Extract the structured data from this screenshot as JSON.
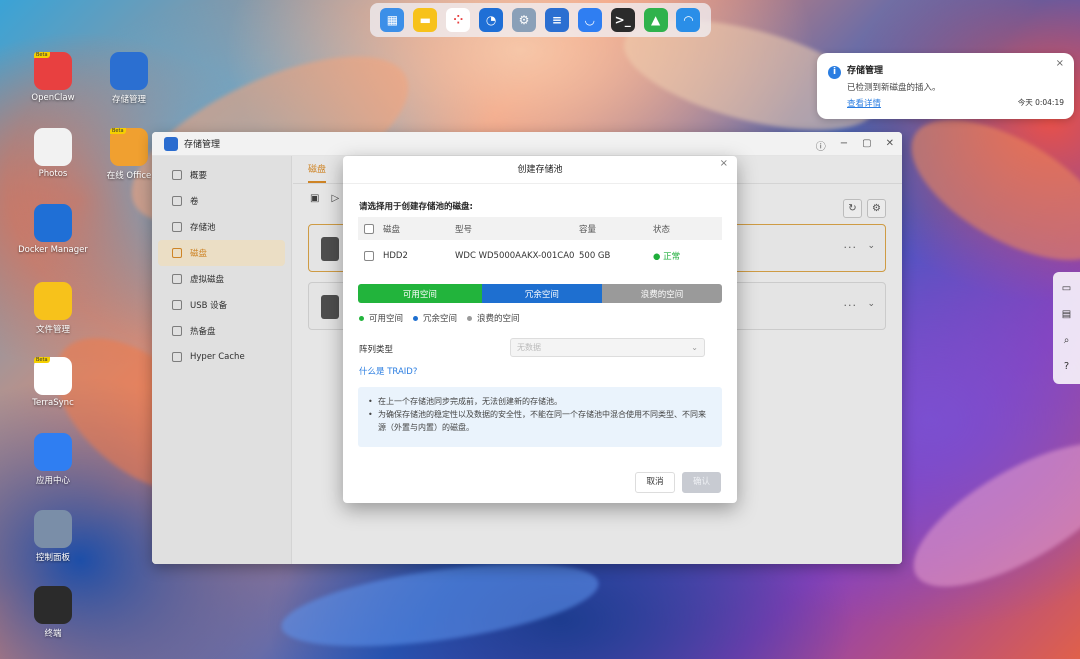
{
  "dock": {
    "items": [
      {
        "name": "window-manager-icon",
        "color": "#3c8fe8",
        "glyph": "▦"
      },
      {
        "name": "notes-icon",
        "color": "#f7c21b",
        "glyph": "▬"
      },
      {
        "name": "apps-grid-icon",
        "color": "#ffffff",
        "glyph": "⁘"
      },
      {
        "name": "clock-icon",
        "color": "#1f6fd6",
        "glyph": "◔"
      },
      {
        "name": "settings-icon",
        "color": "#8aa0b8",
        "glyph": "⚙"
      },
      {
        "name": "storage-icon",
        "color": "#2b6fd1",
        "glyph": "≡"
      },
      {
        "name": "app-center-icon",
        "color": "#2f7ef2",
        "glyph": "◡"
      },
      {
        "name": "terminal-icon",
        "color": "#2b2b2b",
        "glyph": ">_"
      },
      {
        "name": "sync-icon",
        "color": "#2fb24c",
        "glyph": "▲"
      },
      {
        "name": "support-icon",
        "color": "#2a8ee8",
        "glyph": "◠"
      }
    ]
  },
  "desktop": {
    "icons": [
      {
        "name": "openclaw-desktop-icon",
        "label": "OpenClaw",
        "color": "#e84040",
        "beta": "Beta"
      },
      {
        "name": "storage-manager-desktop-icon",
        "label": "存储管理",
        "color": "#2b6fd1"
      },
      {
        "name": "photos-desktop-icon",
        "label": "Photos",
        "color": "#f2f2f2"
      },
      {
        "name": "online-office-desktop-icon",
        "label": "在线 Office",
        "color": "#f0a030",
        "beta": "Beta"
      },
      {
        "name": "docker-manager-desktop-icon",
        "label": "Docker Manager",
        "color": "#1f6fd6"
      },
      {
        "name": "file-manager-desktop-icon",
        "label": "文件管理",
        "color": "#f7c21b"
      },
      {
        "name": "terrasync-desktop-icon",
        "label": "TerraSync",
        "color": "#ffffff",
        "beta": "Beta"
      },
      {
        "name": "app-center-desktop-icon",
        "label": "应用中心",
        "color": "#2f7ef2"
      },
      {
        "name": "control-panel-desktop-icon",
        "label": "控制面板",
        "color": "#7a8ea8"
      },
      {
        "name": "terminal-desktop-icon",
        "label": "终端",
        "color": "#2b2b2b"
      }
    ]
  },
  "notification": {
    "title": "存储管理",
    "message": "已检测到新磁盘的插入。",
    "link": "查看详情",
    "time": "今天 0:04:19",
    "close": "×"
  },
  "window": {
    "title": "存储管理",
    "controls": {
      "help": "ⓘ",
      "min": "−",
      "max": "▢",
      "close": "✕"
    },
    "sidebar": [
      {
        "label": "概要",
        "name": "sidebar-item-overview"
      },
      {
        "label": "卷",
        "name": "sidebar-item-volume"
      },
      {
        "label": "存储池",
        "name": "sidebar-item-storage-pool"
      },
      {
        "label": "磁盘",
        "name": "sidebar-item-disk",
        "active": true
      },
      {
        "label": "虚拟磁盘",
        "name": "sidebar-item-virtual-disk"
      },
      {
        "label": "USB 设备",
        "name": "sidebar-item-usb"
      },
      {
        "label": "热备盘",
        "name": "sidebar-item-hot-spare"
      },
      {
        "label": "Hyper Cache",
        "name": "sidebar-item-hyper-cache"
      }
    ],
    "tab": "磁盘"
  },
  "modal": {
    "title": "创建存储池",
    "close": "×",
    "subtitle": "请选择用于创建存储池的磁盘:",
    "table": {
      "headers": [
        "磁盘",
        "型号",
        "容量",
        "状态"
      ],
      "rows": [
        {
          "disk": "HDD2",
          "model": "WDC WD5000AAKX-001CA0",
          "capacity": "500 GB",
          "status": "正常"
        }
      ]
    },
    "bar": [
      {
        "label": "可用空间",
        "color": "#22b43c",
        "share": 0.34
      },
      {
        "label": "冗余空间",
        "color": "#1e6fd0",
        "share": 0.33
      },
      {
        "label": "浪费的空间",
        "color": "#9a9a9a",
        "share": 0.33
      }
    ],
    "legend": [
      {
        "label": "可用空间",
        "color": "#22b43c"
      },
      {
        "label": "冗余空间",
        "color": "#1e6fd0"
      },
      {
        "label": "浪费的空间",
        "color": "#9a9a9a"
      }
    ],
    "raid_label": "阵列类型",
    "raid_placeholder": "无数据",
    "raid_link": "什么是 TRAID?",
    "notes": [
      "在上一个存储池同步完成前，无法创建新的存储池。",
      "为确保存储池的稳定性以及数据的安全性，不能在同一个存储池中混合使用不同类型、不同来源（外置与内置）的磁盘。"
    ],
    "cancel": "取消",
    "ok": "确认"
  },
  "sidebar_tools": [
    "chat-icon",
    "message-icon",
    "search-icon",
    "help-icon"
  ]
}
